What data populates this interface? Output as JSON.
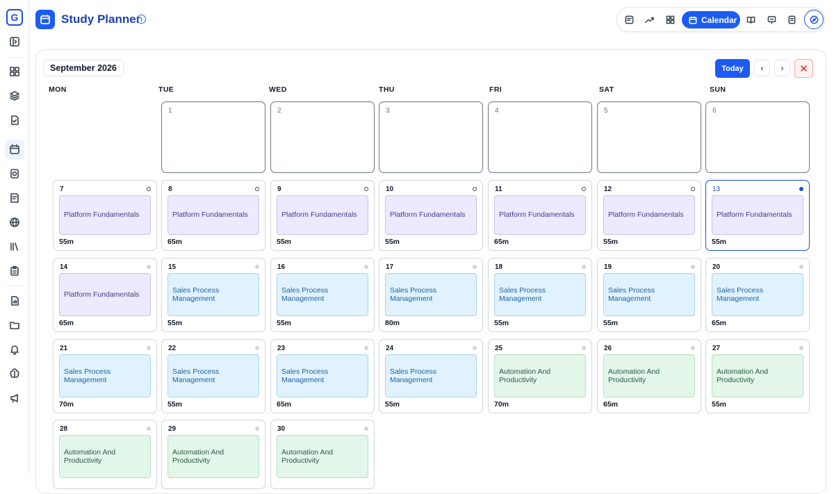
{
  "app": {
    "title": "Study Planner"
  },
  "rail": {
    "items": [
      "panel-toggle",
      "dashboard",
      "layers",
      "document-check",
      "calendar",
      "quiz",
      "notes",
      "globe",
      "library",
      "clipboard",
      "report",
      "folder",
      "bell",
      "brain",
      "megaphone"
    ]
  },
  "toolbar": {
    "calendar_label": "Calendar",
    "icons": [
      "checklist-icon",
      "trend-icon",
      "grid-icon",
      "calendar-icon",
      "book-icon",
      "presentation-icon",
      "bookmark-icon",
      "compass-icon"
    ]
  },
  "calendar": {
    "month_label": "September 2026",
    "today_label": "Today",
    "prev_label": "‹",
    "next_label": "›",
    "close_label": "✕",
    "weekdays": [
      "MON",
      "TUE",
      "WED",
      "THU",
      "FRI",
      "SAT",
      "SUN"
    ],
    "empty_days": [
      "1",
      "2",
      "3",
      "4",
      "5",
      "6"
    ],
    "weeks": [
      [
        {
          "day": "7",
          "event": "Platform Fundamentals",
          "color": "purple",
          "duration": "55m",
          "dot": "hollow"
        },
        {
          "day": "8",
          "event": "Platform Fundamentals",
          "color": "purple",
          "duration": "65m",
          "dot": "hollow"
        },
        {
          "day": "9",
          "event": "Platform Fundamentals",
          "color": "purple",
          "duration": "55m",
          "dot": "hollow"
        },
        {
          "day": "10",
          "event": "Platform Fundamentals",
          "color": "purple",
          "duration": "55m",
          "dot": "hollow"
        },
        {
          "day": "11",
          "event": "Platform Fundamentals",
          "color": "purple",
          "duration": "65m",
          "dot": "hollow"
        },
        {
          "day": "12",
          "event": "Platform Fundamentals",
          "color": "purple",
          "duration": "55m",
          "dot": "hollow"
        },
        {
          "day": "13",
          "event": "Platform Fundamentals",
          "color": "purple",
          "duration": "55m",
          "dot": "blue",
          "today": true
        }
      ],
      [
        {
          "day": "14",
          "event": "Platform Fundamentals",
          "color": "purple",
          "duration": "65m",
          "dot": "gray"
        },
        {
          "day": "15",
          "event": "Sales Process Management",
          "color": "blue",
          "duration": "55m",
          "dot": "gray"
        },
        {
          "day": "16",
          "event": "Sales Process Management",
          "color": "blue",
          "duration": "55m",
          "dot": "gray"
        },
        {
          "day": "17",
          "event": "Sales Process Management",
          "color": "blue",
          "duration": "80m",
          "dot": "gray"
        },
        {
          "day": "18",
          "event": "Sales Process Management",
          "color": "blue",
          "duration": "55m",
          "dot": "gray"
        },
        {
          "day": "19",
          "event": "Sales Process Management",
          "color": "blue",
          "duration": "55m",
          "dot": "gray"
        },
        {
          "day": "20",
          "event": "Sales Process Management",
          "color": "blue",
          "duration": "65m",
          "dot": "gray"
        }
      ],
      [
        {
          "day": "21",
          "event": "Sales Process Management",
          "color": "blue",
          "duration": "70m",
          "dot": "gray"
        },
        {
          "day": "22",
          "event": "Sales Process Management",
          "color": "blue",
          "duration": "55m",
          "dot": "gray"
        },
        {
          "day": "23",
          "event": "Sales Process Management",
          "color": "blue",
          "duration": "65m",
          "dot": "gray"
        },
        {
          "day": "24",
          "event": "Sales Process Management",
          "color": "blue",
          "duration": "55m",
          "dot": "gray"
        },
        {
          "day": "25",
          "event": "Automation And Productivity",
          "color": "green",
          "duration": "70m",
          "dot": "gray"
        },
        {
          "day": "26",
          "event": "Automation And Productivity",
          "color": "green",
          "duration": "65m",
          "dot": "gray"
        },
        {
          "day": "27",
          "event": "Automation And Productivity",
          "color": "green",
          "duration": "55m",
          "dot": "gray"
        }
      ],
      [
        {
          "day": "28",
          "event": "Automation And Productivity",
          "color": "green",
          "duration": "",
          "dot": "gray"
        },
        {
          "day": "29",
          "event": "Automation And Productivity",
          "color": "green",
          "duration": "",
          "dot": "gray"
        },
        {
          "day": "30",
          "event": "Automation And Productivity",
          "color": "green",
          "duration": "",
          "dot": "gray"
        }
      ]
    ]
  }
}
